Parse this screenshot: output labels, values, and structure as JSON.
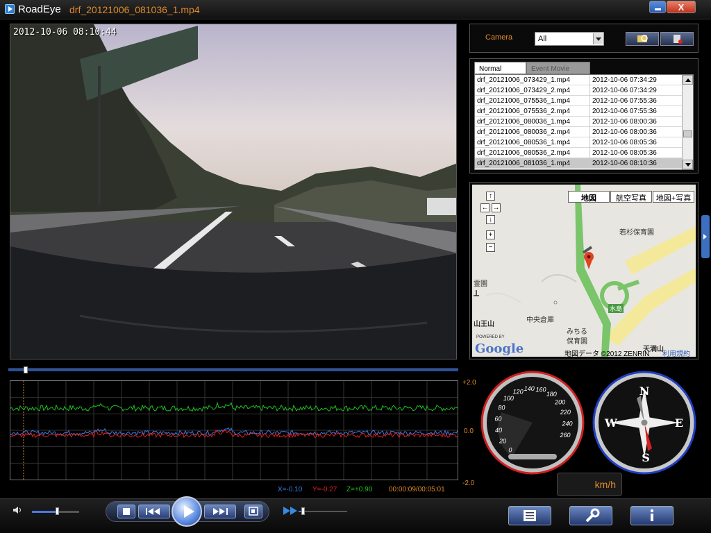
{
  "window": {
    "app_name": "RoadEye",
    "file_name": "drf_20121006_081036_1.mp4",
    "close_label": "X"
  },
  "video": {
    "timestamp": "2012-10-06 08:10:44"
  },
  "camera": {
    "label": "Camera",
    "selected": "All"
  },
  "tabs": [
    {
      "label": "Normal Movie"
    },
    {
      "label": "Event Movie"
    }
  ],
  "files": [
    {
      "name": "drf_20121006_073429_1.mp4",
      "date": "2012-10-06 07:34:29"
    },
    {
      "name": "drf_20121006_073429_2.mp4",
      "date": "2012-10-06 07:34:29"
    },
    {
      "name": "drf_20121006_075536_1.mp4",
      "date": "2012-10-06 07:55:36"
    },
    {
      "name": "drf_20121006_075536_2.mp4",
      "date": "2012-10-06 07:55:36"
    },
    {
      "name": "drf_20121006_080036_1.mp4",
      "date": "2012-10-06 08:00:36"
    },
    {
      "name": "drf_20121006_080036_2.mp4",
      "date": "2012-10-06 08:00:36"
    },
    {
      "name": "drf_20121006_080536_1.mp4",
      "date": "2012-10-06 08:05:36"
    },
    {
      "name": "drf_20121006_080536_2.mp4",
      "date": "2012-10-06 08:05:36"
    },
    {
      "name": "drf_20121006_081036_1.mp4",
      "date": "2012-10-06 08:10:36"
    }
  ],
  "map": {
    "types": [
      "地図",
      "航空写真",
      "地図+写真"
    ],
    "labels": {
      "hoikuen": "若杉保育園",
      "souko": "中央倉庫",
      "michiru": "みちる",
      "hoikuen2": "保育園",
      "yamaou": "山王山",
      "reien": "霊園",
      "mizushima": "水島",
      "tenman": "天満山"
    },
    "powered": "POWERED BY",
    "google": "Google",
    "copyright": "地図データ ©2012 ZENRIN",
    "terms": "利用規約"
  },
  "graph": {
    "max": "+2.0",
    "mid": "0.0",
    "min": "-2.0",
    "x": "X=-0.10",
    "y": "Y=-0.27",
    "z": "Z=+0.90",
    "time": "00:00:09/00:05:01"
  },
  "speedometer": {
    "ticks": [
      "0",
      "20",
      "40",
      "60",
      "80",
      "100",
      "120",
      "140",
      "160",
      "180",
      "200",
      "220",
      "240",
      "260"
    ],
    "unit": "km/h"
  },
  "compass": {
    "n": "N",
    "e": "E",
    "s": "S",
    "w": "W"
  },
  "colors": {
    "accent": "#e08a2a",
    "x_axis": "#3a7ae0",
    "y_axis": "#e02020",
    "z_axis": "#20c020"
  }
}
